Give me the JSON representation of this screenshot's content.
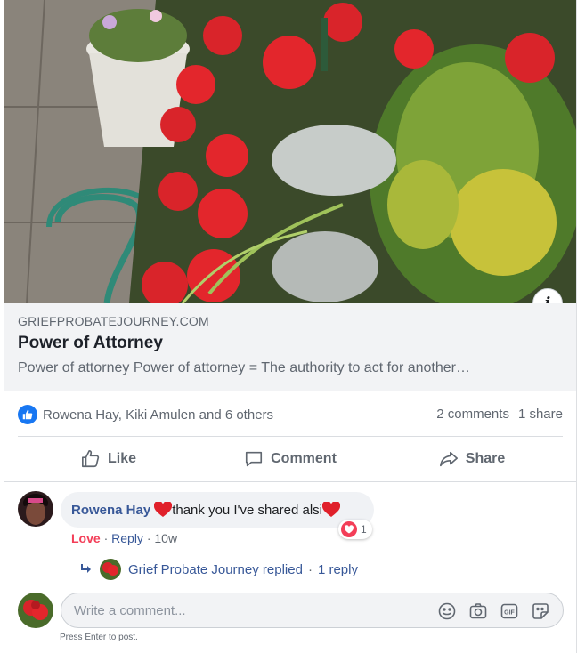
{
  "link_preview": {
    "domain": "GRIEFPROBATEJOURNEY.COM",
    "title": "Power of Attorney",
    "description": "Power of attorney Power of attorney = The authority to act for another…"
  },
  "post_info": {
    "icon": "info-icon",
    "symbol": "i"
  },
  "reactions": {
    "reactors": "Rowena Hay, Kiki Amulen and 6 others",
    "comments": "2 comments",
    "shares": "1 share",
    "colors": {
      "like": "#1877f2",
      "love": "#f33e58"
    }
  },
  "actions": {
    "like_label": "Like",
    "comment_label": "Comment",
    "share_label": "Share"
  },
  "comment": {
    "author": "Rowena Hay",
    "text": "thank you I've shared alsi",
    "reaction_count": "1",
    "love_label": "Love",
    "reply_label": "Reply",
    "time": "10w",
    "separator": "·"
  },
  "replies_summary": {
    "text": "Grief Probate Journey replied",
    "count": "1 reply",
    "separator": "·"
  },
  "write_comment": {
    "placeholder": "Write a comment...",
    "hint": "Press Enter to post.",
    "icons": [
      "emoji-icon",
      "camera-icon",
      "gif-icon",
      "sticker-icon"
    ]
  }
}
